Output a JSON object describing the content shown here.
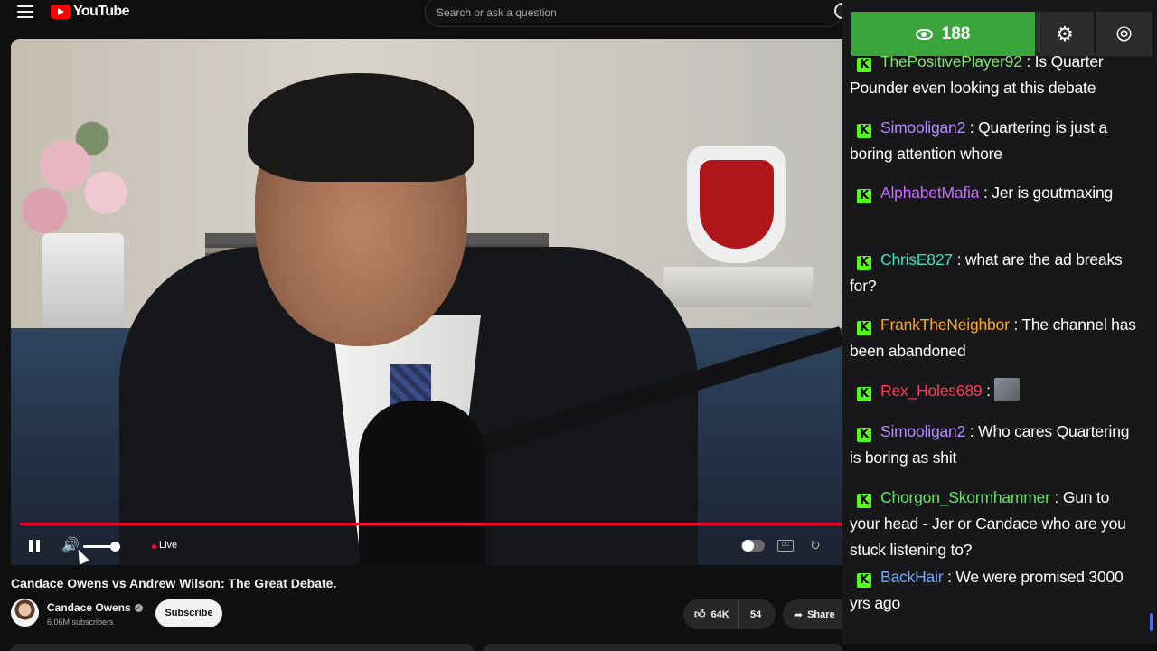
{
  "header": {
    "logo_text": "YouTube",
    "search_placeholder": "Search or ask a question"
  },
  "player": {
    "live_label": "Live",
    "progress_fraction": 1.0,
    "volume_fraction": 0.6,
    "cc_label": "CC"
  },
  "video": {
    "title": "Candace Owens vs Andrew Wilson: The Great Debate.",
    "channel_name": "Candace Owens",
    "subscribers": "6.06M subscribers",
    "subscribe_label": "Subscribe",
    "likes": "64K",
    "dislikes": "54",
    "share_label": "Share"
  },
  "chat": {
    "viewer_count": "188",
    "messages": [
      {
        "user": "ThePositivePlayer92",
        "color": "#7ee36a",
        "text": "Is Quarter Pounder even looking at this debate",
        "sep": " : "
      },
      {
        "user": "Simooligan2",
        "color": "#b48cff",
        "text": "Quartering is just a boring attention whore",
        "sep": " : "
      },
      {
        "user": "AlphabetMafia",
        "color": "#c46cff",
        "text": "Jer is goutmaxing",
        "sep": " : "
      },
      {
        "user": "ChrisE827",
        "color": "#3fe0b5",
        "text": "what are the ad breaks for?",
        "sep": " : "
      },
      {
        "user": "FrankTheNeighbor",
        "color": "#f5a623",
        "text": "The channel has been abandoned",
        "sep": " : "
      },
      {
        "user": "Rex_Holes689",
        "color": "#ff3b55",
        "text": "",
        "sep": " : ",
        "emote": true
      },
      {
        "user": "Simooligan2",
        "color": "#b48cff",
        "text": "Who cares Quartering is boring as shit",
        "sep": " : "
      },
      {
        "user": "Chorgon_Skormhammer",
        "color": "#66e26a",
        "text": "Gun to your head - Jer or Candace who are you stuck listening to?",
        "sep": " : "
      },
      {
        "user": "BackHair",
        "color": "#6fa8ff",
        "text": "We were promised 3000 yrs ago",
        "sep": " : "
      }
    ]
  },
  "colors": {
    "accent_red": "#ff0033",
    "viewer_green": "#3aa53a",
    "kick_green": "#53fc18"
  }
}
